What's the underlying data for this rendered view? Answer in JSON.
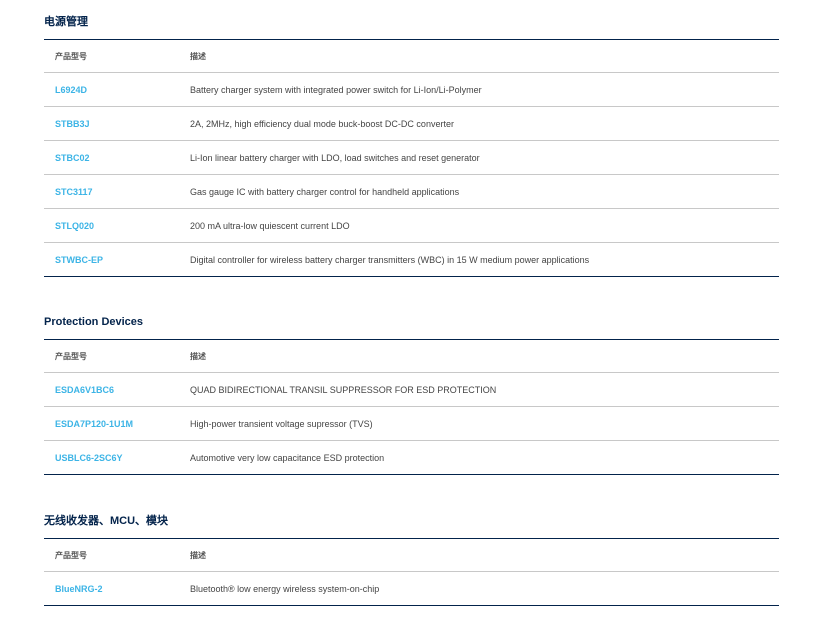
{
  "sections": [
    {
      "title": "电源管理",
      "headers": {
        "part": "产品型号",
        "desc": "描述"
      },
      "rows": [
        {
          "part": "L6924D",
          "desc": "Battery charger system with integrated power switch for Li-Ion/Li-Polymer"
        },
        {
          "part": "STBB3J",
          "desc": "2A, 2MHz, high efficiency dual mode buck-boost DC-DC converter"
        },
        {
          "part": "STBC02",
          "desc": "Li-Ion linear battery charger with LDO, load switches and reset generator"
        },
        {
          "part": "STC3117",
          "desc": "Gas gauge IC with battery charger control for handheld applications"
        },
        {
          "part": "STLQ020",
          "desc": "200 mA ultra-low quiescent current LDO"
        },
        {
          "part": "STWBC-EP",
          "desc": "Digital controller for wireless battery charger transmitters (WBC) in 15 W medium power applications"
        }
      ]
    },
    {
      "title": "Protection Devices",
      "headers": {
        "part": "产品型号",
        "desc": "描述"
      },
      "rows": [
        {
          "part": "ESDA6V1BC6",
          "desc": "QUAD BIDIRECTIONAL TRANSIL SUPPRESSOR FOR ESD PROTECTION"
        },
        {
          "part": "ESDA7P120-1U1M",
          "desc": "High-power transient voltage supressor (TVS)"
        },
        {
          "part": "USBLC6-2SC6Y",
          "desc": "Automotive very low capacitance ESD protection"
        }
      ]
    },
    {
      "title": "无线收发器、MCU、模块",
      "headers": {
        "part": "产品型号",
        "desc": "描述"
      },
      "rows": [
        {
          "part": "BlueNRG-2",
          "desc": "Bluetooth® low energy wireless system-on-chip"
        }
      ]
    }
  ],
  "colors": {
    "title": "#03234b",
    "link": "#3cb4e6",
    "rule_dark": "#03234b",
    "rule_light": "#c8c8c8"
  }
}
